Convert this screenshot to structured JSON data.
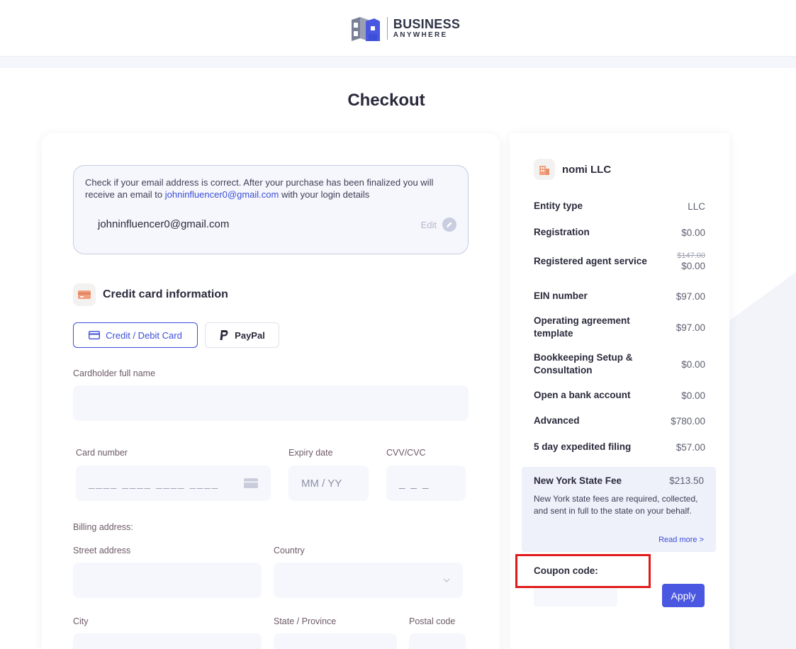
{
  "header": {
    "logo_line1": "BUSINESS",
    "logo_line2": "ANYWHERE"
  },
  "page_title": "Checkout",
  "email_section": {
    "notice_part1": "Check if your email address is correct. After your purchase has been finalized you will receive an email to ",
    "notice_email": "johninfluencer0@gmail.com",
    "notice_part2": " with your login details",
    "email_value": "johninfluencer0@gmail.com",
    "edit_label": "Edit"
  },
  "payment": {
    "section_title": "Credit card information",
    "tab_card": "Credit / Debit Card",
    "tab_paypal": "PayPal",
    "cardholder_label": "Cardholder full name",
    "card_number_label": "Card number",
    "card_number_placeholder": "____ ____ ____ ____",
    "expiry_label": "Expiry date",
    "expiry_placeholder": "MM / YY",
    "cvv_label": "CVV/CVC",
    "cvv_placeholder": "_ _ _",
    "billing_label": "Billing address:",
    "street_label": "Street address",
    "country_label": "Country",
    "city_label": "City",
    "state_label": "State / Province",
    "postal_label": "Postal code"
  },
  "summary": {
    "company_name": "nomi LLC",
    "items": [
      {
        "label": "Entity type",
        "price": "LLC"
      },
      {
        "label": "Registration",
        "price": "$0.00"
      },
      {
        "label": "Registered agent service",
        "old_price": "$147.00",
        "price": "$0.00"
      },
      {
        "label": "EIN number",
        "price": "$97.00"
      },
      {
        "label": "Operating agreement template",
        "price": "$97.00"
      },
      {
        "label": "Bookkeeping Setup & Consultation",
        "price": "$0.00"
      },
      {
        "label": "Open a bank account",
        "price": "$0.00"
      },
      {
        "label": "Advanced",
        "price": "$780.00"
      },
      {
        "label": "5 day expedited filing",
        "price": "$57.00"
      }
    ],
    "state_fee": {
      "title": "New York State Fee",
      "price": "$213.50",
      "description": "New York state fees are required, collected, and sent in full to the state on your behalf.",
      "read_more": "Read more >"
    },
    "coupon_label": "Coupon code:",
    "apply_label": "Apply"
  },
  "colors": {
    "accent": "#3b4fd8",
    "apply_button": "#4a57e0",
    "highlight": "#e01b1b",
    "icon_orange": "#f0a07e"
  },
  "icons": [
    "logo-icon",
    "pencil-icon",
    "credit-card-icon",
    "paypal-icon",
    "building-icon",
    "chevron-down-icon"
  ]
}
